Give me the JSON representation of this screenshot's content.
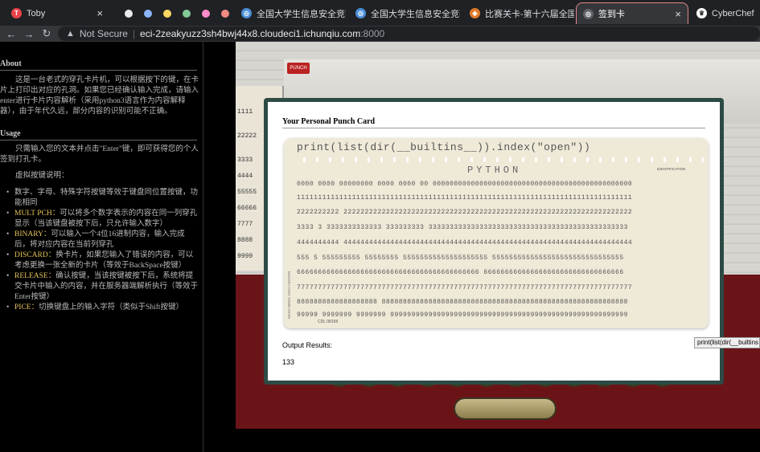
{
  "browser": {
    "tabs": [
      {
        "title": "Toby",
        "icon": "toby-icon"
      },
      {
        "title": "全国大学生信息安全竞赛官",
        "icon": "globe-icon"
      },
      {
        "title": "全国大学生信息安全竞赛官",
        "icon": "globe-icon"
      },
      {
        "title": "比赛关卡-第十六届全国大",
        "icon": "site-icon"
      },
      {
        "title": "签到卡",
        "icon": "globe-icon",
        "active": true
      },
      {
        "title": "CyberChef",
        "icon": "chef-icon"
      }
    ],
    "dot_colors": [
      "#e8eaed",
      "#8ab4f8",
      "#fdd663",
      "#81c995",
      "#ff8bcb",
      "#f28b82"
    ],
    "security_label": "Not Secure",
    "url_host": "eci-2zeakyuzz3sh4bwj44x8.cloudeci1.ichunqiu.com",
    "url_port": ":8000"
  },
  "sidebar": {
    "about_title": "About",
    "about_text": "这是一台老式的穿孔卡片机，可以根据按下的键，在卡片上打印出对应的孔洞。如果您已经确认输入完成，请输入enter进行卡片内容解析（采用python3语言作为内容解释器），由于年代久远，部分内容的识别可能不正确。",
    "usage_title": "Usage",
    "usage_text": "只需输入您的文本并点击\"Enter\"键，即可获得您的个人签到打孔卡。",
    "keys_intro": "虚拟按键说明：",
    "keys": [
      {
        "name": "",
        "desc": "数字、字母、特殊字符按键等效于键盘同位置按键，功能相同"
      },
      {
        "name": "MULT PCH：",
        "desc": "可以将多个数字表示的内容在同一列穿孔显示（当该键盘被按下后，只允许输入数字）"
      },
      {
        "name": "BINARY：",
        "desc": "可以输入一个4位16进制内容，输入完成后，将对应内容在当前列穿孔"
      },
      {
        "name": "DISCARD：",
        "desc": "换卡片，如果您输入了错误的内容，可以考虑更换一张全新的卡片（等效于BackSpace按键）"
      },
      {
        "name": "RELEASE：",
        "desc": "确认按键，当该按键被按下后，系统将提交卡片中输入的内容，并在服务器端解析执行（等效于Enter按键）"
      },
      {
        "name": "PICE：",
        "desc": "切换键盘上的输入字符（类似于Shift按键）"
      }
    ]
  },
  "scene": {
    "punch_label": "PUNCH"
  },
  "modal": {
    "title": "Your Personal Punch Card",
    "card_text": "print(list(dir(__builtins__)).index(\"open\"))",
    "card_brand": "PYTHON",
    "card_ident": "IDENTIFICATION",
    "card_side": "MASS WEEK DATA CENTER",
    "card_foot": "CDL 08158",
    "rows": [
      "0000 0000 00000000 0000 0000 00 00000000000000000000000000000000000000000000000",
      "1111111111111111111111111111111111111111111111111111111111111111111111111111111",
      "2222222222 22222222222222222222222222222222222222222222222222222222222222222222",
      "3333 3 3333333333333 333333333 33333333333333333333333333333333333333333333333",
      "4444444444 44444444444444444444444444444444444444444444444444444444444444444444",
      "555 5 555555555 55555555 55555555555555555555 5555555555555555555555555555555",
      "6666666666666666666666666666666666666666666 666666666666666666666666666666666",
      "7777777777777777777777777777777777777777777777777777777777777777777777777777777",
      "8888888888888888888 8888888888888888888888888888888888888888888888888888888888",
      "99999 9999999 9999999 99999999999999999999999999999999999999999999999999999999"
    ],
    "output_label": "Output Results:",
    "output_value": "133"
  },
  "tooltip": "print(list(dir(__builtins"
}
